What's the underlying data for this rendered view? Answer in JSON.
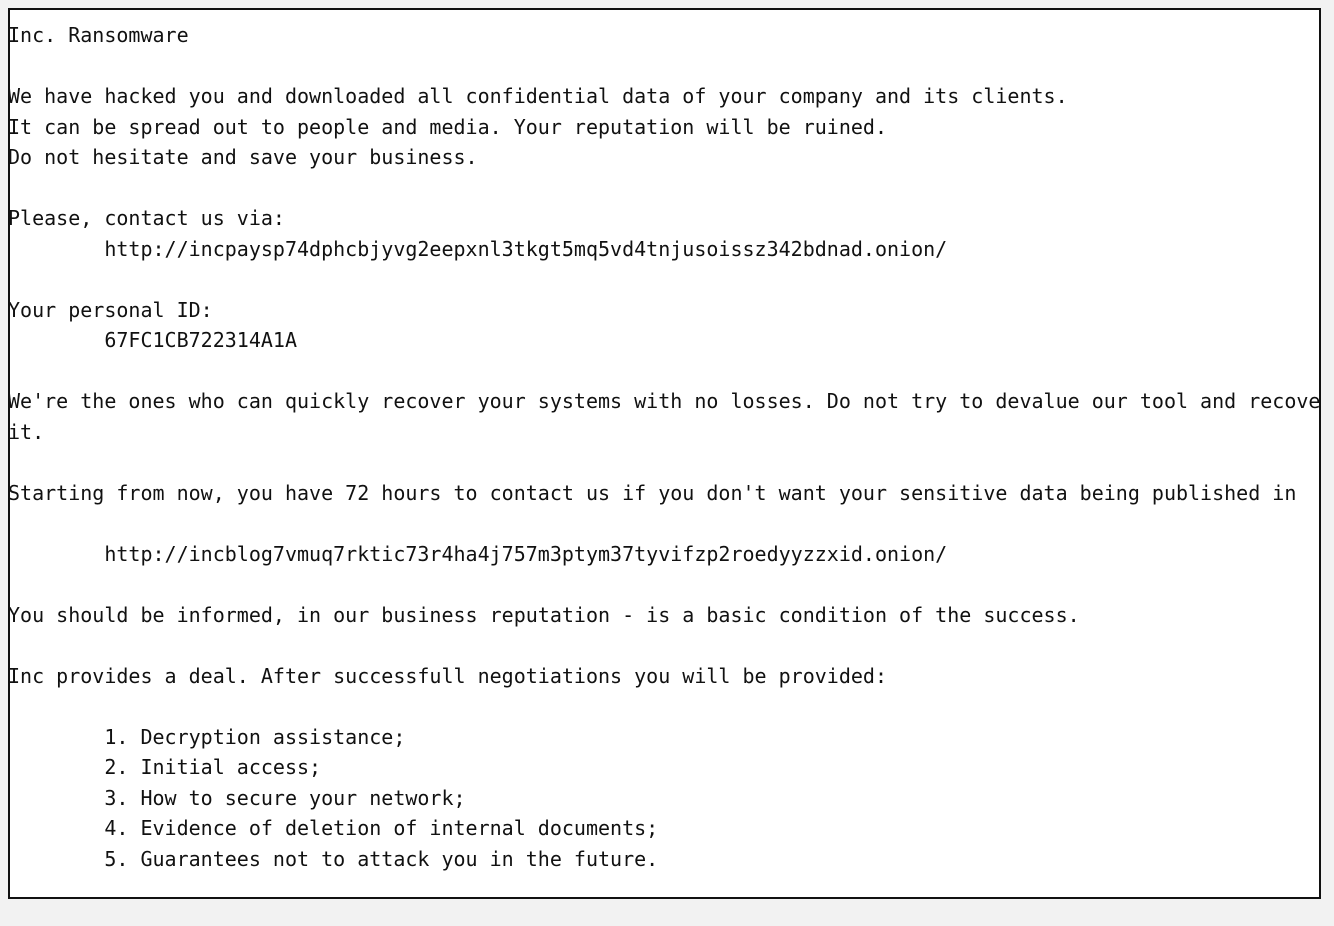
{
  "window": {
    "name": "ransom-note-text-box",
    "border_color": "#111111",
    "background_color": "#ffffff",
    "page_background_color": "#f2f2f2"
  },
  "note": {
    "title": "Inc. Ransomware",
    "lines": [
      {
        "id": "title",
        "text": "Inc. Ransomware",
        "type": "heading"
      },
      {
        "id": "blank-1",
        "text": "",
        "type": "blank"
      },
      {
        "id": "intro-1",
        "text": "We have hacked you and downloaded all confidential data of your company and its clients.",
        "type": "body"
      },
      {
        "id": "intro-2",
        "text": "It can be spread out to people and media. Your reputation will be ruined.",
        "type": "body"
      },
      {
        "id": "intro-3",
        "text": "Do not hesitate and save your business.",
        "type": "body"
      },
      {
        "id": "blank-2",
        "text": "",
        "type": "blank"
      },
      {
        "id": "contact-label",
        "text": "Please, contact us via:",
        "type": "body"
      },
      {
        "id": "contact-url",
        "text": "        http://incpaysp74dphcbjyvg2eepxnl3tkgt5mq5vd4tnjusoissz342bdnad.onion/",
        "type": "url"
      },
      {
        "id": "blank-3",
        "text": "",
        "type": "blank"
      },
      {
        "id": "id-label",
        "text": "Your personal ID:",
        "type": "body"
      },
      {
        "id": "id-value",
        "text": "        67FC1CB722314A1A",
        "type": "value"
      },
      {
        "id": "blank-4",
        "text": "",
        "type": "blank"
      },
      {
        "id": "recover-1",
        "text": "We're the ones who can quickly recover your systems with no losses. Do not try to devalue our tool and recover",
        "type": "body"
      },
      {
        "id": "recover-2",
        "text": "it.",
        "type": "body"
      },
      {
        "id": "blank-5",
        "text": "",
        "type": "blank"
      },
      {
        "id": "deadline",
        "text": "Starting from now, you have 72 hours to contact us if you don't want your sensitive data being published in",
        "type": "body"
      },
      {
        "id": "blank-6",
        "text": "",
        "type": "blank"
      },
      {
        "id": "blog-url",
        "text": "        http://incblog7vmuq7rktic73r4ha4j757m3ptym37tyvifzp2roedyyzzxid.onion/",
        "type": "url"
      },
      {
        "id": "blank-7",
        "text": "",
        "type": "blank"
      },
      {
        "id": "reputation",
        "text": "You should be informed, in our business reputation - is a basic condition of the success.",
        "type": "body"
      },
      {
        "id": "blank-8",
        "text": "",
        "type": "blank"
      },
      {
        "id": "deal-intro",
        "text": "Inc provides a deal. After successfull negotiations you will be provided:",
        "type": "body"
      },
      {
        "id": "blank-9",
        "text": "",
        "type": "blank"
      },
      {
        "id": "deal-1",
        "text": "        1. Decryption assistance;",
        "type": "list"
      },
      {
        "id": "deal-2",
        "text": "        2. Initial access;",
        "type": "list"
      },
      {
        "id": "deal-3",
        "text": "        3. How to secure your network;",
        "type": "list"
      },
      {
        "id": "deal-4",
        "text": "        4. Evidence of deletion of internal documents;",
        "type": "list"
      },
      {
        "id": "deal-5",
        "text": "        5. Guarantees not to attack you in the future.",
        "type": "list"
      }
    ],
    "personal_id": "67FC1CB722314A1A",
    "contact_url": "http://incpaysp74dphcbjyvg2eepxnl3tkgt5mq5vd4tnjusoissz342bdnad.onion/",
    "blog_url": "http://incblog7vmuq7rktic73r4ha4j757m3ptym37tyvifzp2roedyyzzxid.onion/",
    "deadline_hours": "72",
    "demands": [
      "Decryption assistance;",
      "Initial access;",
      "How to secure your network;",
      "Evidence of deletion of internal documents;",
      "Guarantees not to attack you in the future."
    ]
  }
}
